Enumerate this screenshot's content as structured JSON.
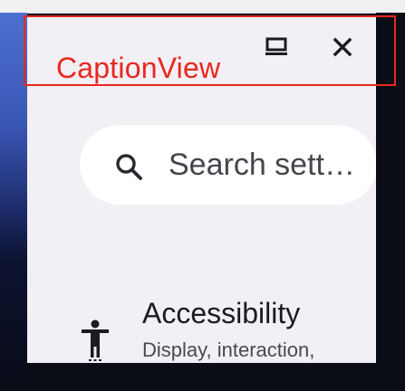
{
  "caption": {
    "label": "CaptionView",
    "maximize_icon": "maximize-icon",
    "close_icon": "close-icon"
  },
  "search": {
    "placeholder": "Search sett…",
    "icon": "search-icon"
  },
  "settings_items": [
    {
      "title": "Accessibility",
      "summary": "Display, interaction, audio",
      "icon": "accessibility-icon"
    }
  ],
  "colors": {
    "annotation_red": "#e8281e",
    "window_background": "#f2eff5",
    "search_background": "#ffffff",
    "text_primary": "#1c1b20",
    "text_secondary": "#4a4850"
  }
}
